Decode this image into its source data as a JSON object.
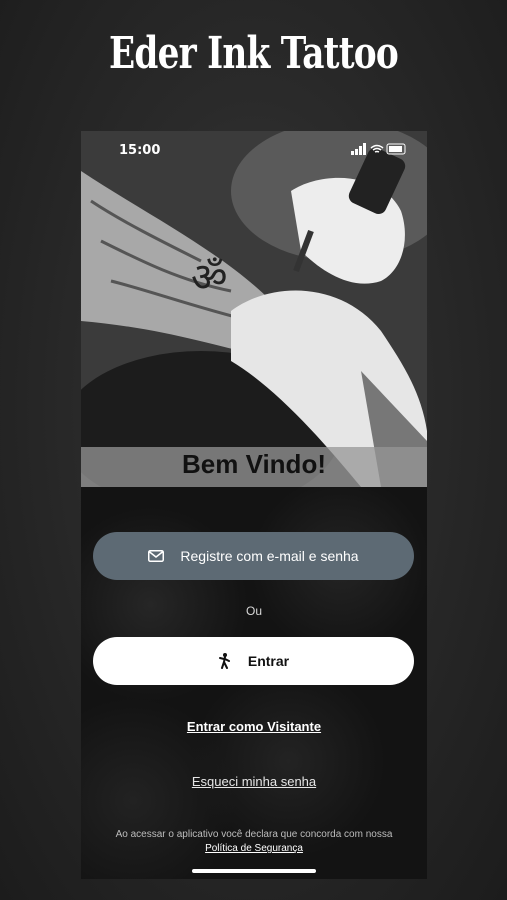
{
  "promo": {
    "title": "Eder Ink Tattoo"
  },
  "status_bar": {
    "time": "15:00"
  },
  "hero": {
    "welcome": "Bem Vindo!"
  },
  "auth": {
    "register_label": "Registre com e-mail e senha",
    "or_label": "Ou",
    "enter_label": "Entrar",
    "visitor_label": "Entrar como Visitante",
    "forgot_label": "Esqueci minha senha",
    "terms_text": "Ao acessar o aplicativo você declara que concorda com nossa",
    "terms_link": "Política de Segurança"
  },
  "icons": {
    "register": "mail-icon",
    "enter": "person-walking-icon"
  },
  "colors": {
    "register_button": "#5d6a74",
    "enter_button": "#ffffff",
    "background": "#131313"
  }
}
